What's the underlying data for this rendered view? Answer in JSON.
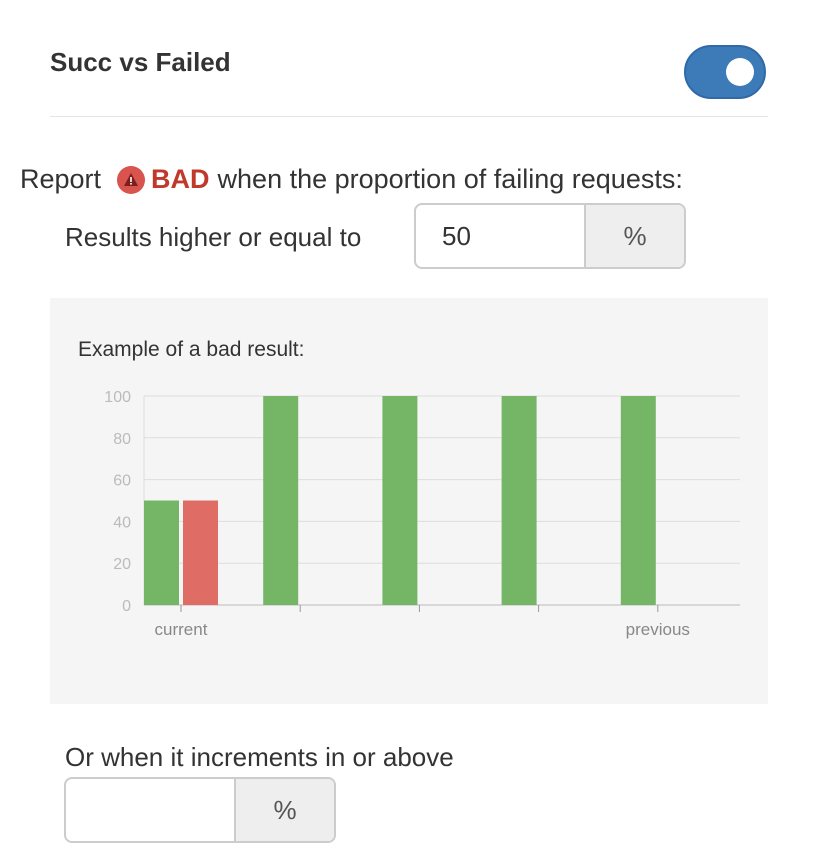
{
  "header": {
    "title": "Succ vs Failed",
    "toggle_on": true
  },
  "report": {
    "prefix": "Report",
    "icon": "warning-triangle-icon",
    "status": "BAD",
    "suffix": "when the proportion of failing requests:"
  },
  "threshold": {
    "label": "Results higher or equal to",
    "value": "50",
    "unit": "%"
  },
  "example": {
    "label": "Example of a bad result:"
  },
  "increment": {
    "label": "Or when it increments in or above",
    "value": "",
    "unit": "%"
  },
  "colors": {
    "accent": "#3d7ab8",
    "bad": "#c0392b",
    "success_bar": "#74b666",
    "failed_bar": "#e06c66"
  },
  "chart_data": {
    "type": "bar",
    "categories": [
      "current",
      "",
      "",
      "",
      "previous"
    ],
    "series": [
      {
        "values": [
          50,
          100,
          100,
          100,
          100
        ]
      },
      {
        "values": [
          50,
          0,
          0,
          0,
          0
        ]
      }
    ],
    "yticks": [
      0,
      20,
      40,
      60,
      80,
      100
    ],
    "ylim": [
      0,
      100
    ],
    "grid": true
  }
}
